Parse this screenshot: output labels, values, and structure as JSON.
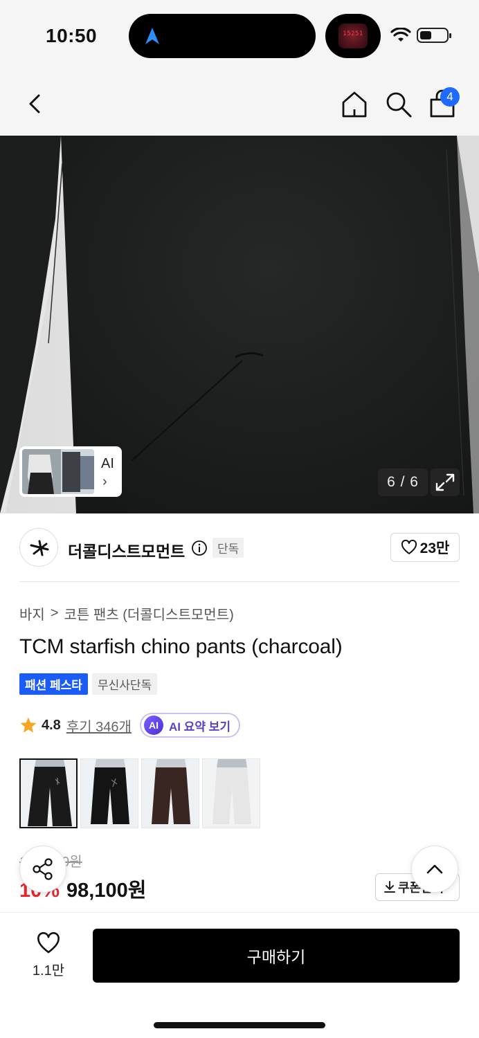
{
  "status_bar": {
    "time": "10:50",
    "live_activity_text": "15251",
    "battery_level_pct": 45
  },
  "header": {
    "cart_count": "4"
  },
  "gallery": {
    "ai_label": "AI",
    "ai_chevron": "›",
    "counter": "6 / 6"
  },
  "brand": {
    "name": "더콜디스트모먼트",
    "exclusive": "단독",
    "likes": "23만"
  },
  "breadcrumb": {
    "category": "바지",
    "separator": ">",
    "subcategory": "코튼 팬츠 (더콜디스트모먼트)"
  },
  "product": {
    "title": "TCM starfish chino pants (charcoal)",
    "badges": [
      "패션 페스타",
      "무신사단독"
    ],
    "rating": "4.8",
    "reviews": "후기 346개",
    "ai_summary_icon": "AI",
    "ai_summary": "AI 요약 보기"
  },
  "colors": [
    {
      "name": "black",
      "pant_color": "#1a1a1a",
      "selected": true
    },
    {
      "name": "black-star",
      "pant_color": "#141414",
      "selected": false
    },
    {
      "name": "brown",
      "pant_color": "#3a2620",
      "selected": false
    },
    {
      "name": "white",
      "pant_color": "#e6e6e6",
      "selected": false
    }
  ],
  "price": {
    "original": "109,000원",
    "discount": "10%",
    "final": "98,100원",
    "coupon_label": "쿠폰받기"
  },
  "bottom_bar": {
    "like_count": "1.1만",
    "buy_label": "구매하기"
  },
  "icons": {
    "back": "chevron-left-icon",
    "home": "home-icon",
    "search": "search-icon",
    "cart": "shopping-bag-icon",
    "share": "share-icon",
    "scroll_top": "chevron-up-icon",
    "heart": "heart-icon",
    "star": "star-icon",
    "expand": "expand-icon",
    "info": "info-icon",
    "download": "download-icon"
  },
  "accent_colors": {
    "blue": "#1a5cf5",
    "red": "#e8262c",
    "purple": "#5a3fc7",
    "star": "#f5a623"
  }
}
